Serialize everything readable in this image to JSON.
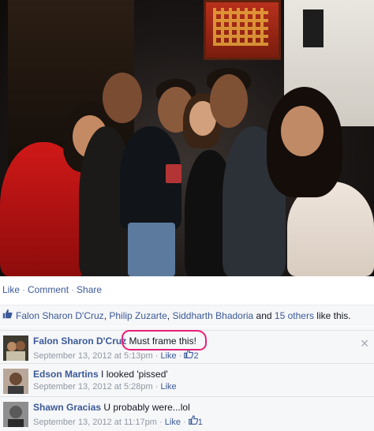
{
  "actions": {
    "like": "Like",
    "sep1": "·",
    "comment": "Comment",
    "sep2": "·",
    "share": "Share"
  },
  "likes": {
    "names": [
      "Falon Sharon D'Cruz",
      "Philip Zuzarte",
      "Siddharth Bhadoria"
    ],
    "comma1": ",",
    "comma2": ",",
    "and": "and",
    "others": "15 others",
    "suffix": "like this."
  },
  "comments": [
    {
      "author": "Falon Sharon D'Cruz",
      "text": "Must frame this!",
      "time": "September 13, 2012 at 5:13pm",
      "like_label": "Like",
      "like_count": "2"
    },
    {
      "author": "Edson Martins",
      "text": "I looked 'pissed'",
      "time": "September 13, 2012 at 5:28pm",
      "like_label": "Like",
      "like_count": ""
    },
    {
      "author": "Shawn Gracias",
      "text": "U probably were...lol",
      "time": "September 13, 2012 at 11:17pm",
      "like_label": "Like",
      "like_count": "1"
    }
  ],
  "colors": {
    "link": "#3b5998",
    "highlight": "#e8207a",
    "meta": "#9197a3"
  }
}
